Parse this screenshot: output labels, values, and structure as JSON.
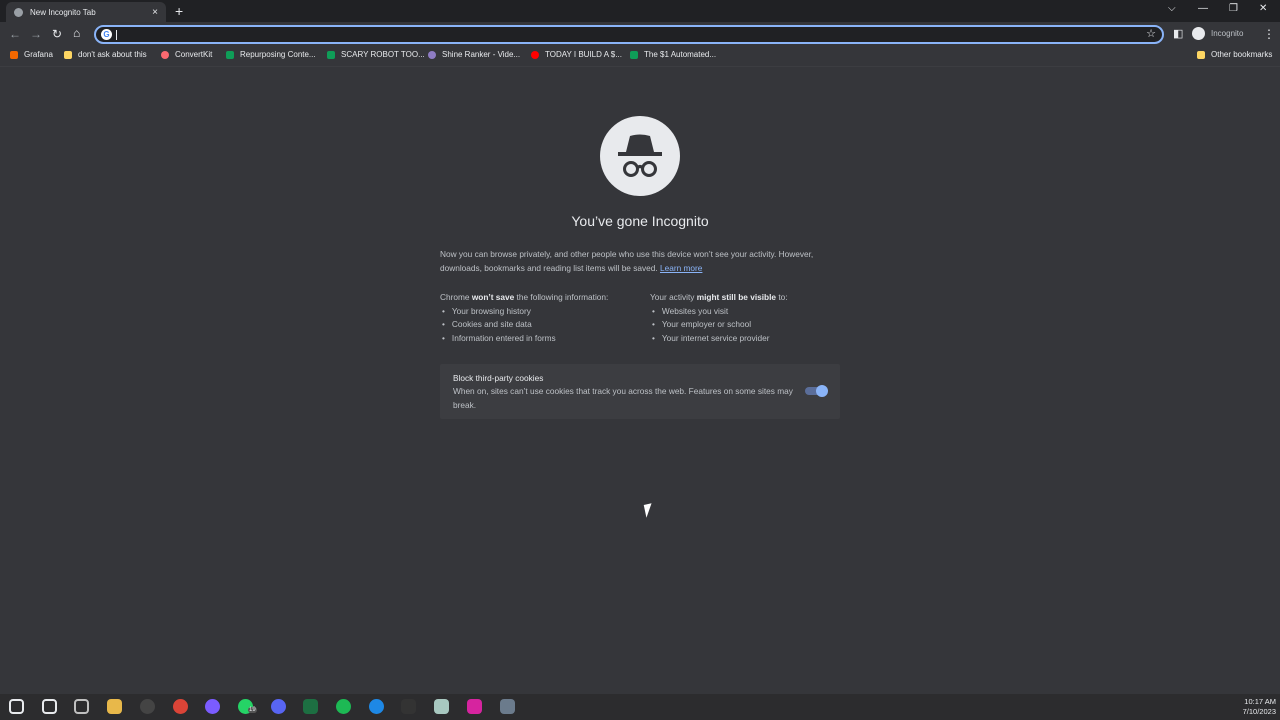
{
  "tab": {
    "title": "New Incognito Tab",
    "close": "×",
    "new_tab": "+"
  },
  "window": {
    "dropdown": "⌵",
    "minimize": "—",
    "restore": "❐",
    "close": "✕"
  },
  "toolbar": {
    "back": "←",
    "forward": "→",
    "reload": "↻",
    "home": "⌂",
    "address_value": "",
    "star": "☆",
    "profile_label": "Incognito",
    "menu": "⋮",
    "sidepanel": "◧"
  },
  "bookmarks": [
    {
      "label": "Grafana",
      "color": "#f46800"
    },
    {
      "label": "don't ask about this",
      "color": "#fdd663"
    },
    {
      "label": "ConvertKit",
      "color": "#fb6970"
    },
    {
      "label": "Repurposing Conte...",
      "color": "#0f9d58"
    },
    {
      "label": "SCARY ROBOT TOO...",
      "color": "#0f9d58"
    },
    {
      "label": "Shine Ranker - Vide...",
      "color": "#8e7cc3"
    },
    {
      "label": "TODAY I BUILD A $...",
      "color": "#ff0000"
    },
    {
      "label": "The $1 Automated...",
      "color": "#0f9d58"
    }
  ],
  "other_bookmarks": "Other bookmarks",
  "page": {
    "title": "You’ve gone Incognito",
    "intro": "Now you can browse privately, and other people who use this device won’t see your activity. However, downloads, bookmarks and reading list items will be saved.",
    "learn_more": "Learn more",
    "left_pre": "Chrome ",
    "left_bold": "won’t save",
    "left_post": " the following information:",
    "left_items": [
      "Your browsing history",
      "Cookies and site data",
      "Information entered in forms"
    ],
    "right_pre": "Your activity ",
    "right_bold": "might still be visible",
    "right_post": " to:",
    "right_items": [
      "Websites you visit",
      "Your employer or school",
      "Your internet service provider"
    ],
    "cookie_title": "Block third-party cookies",
    "cookie_desc": "When on, sites can’t use cookies that track you across the web. Features on some sites may break.",
    "cookie_toggle_on": true
  },
  "taskbar": {
    "icons": [
      "windows-start",
      "search",
      "task-view",
      "file-explorer",
      "media-player",
      "chrome",
      "messenger",
      "whatsapp",
      "discord",
      "excel",
      "spotify",
      "edge",
      "app-red-dot",
      "notepad",
      "instagram",
      "calculator"
    ],
    "whatsapp_badge": "19",
    "time": "10:17 AM",
    "date": "7/10/2023"
  }
}
